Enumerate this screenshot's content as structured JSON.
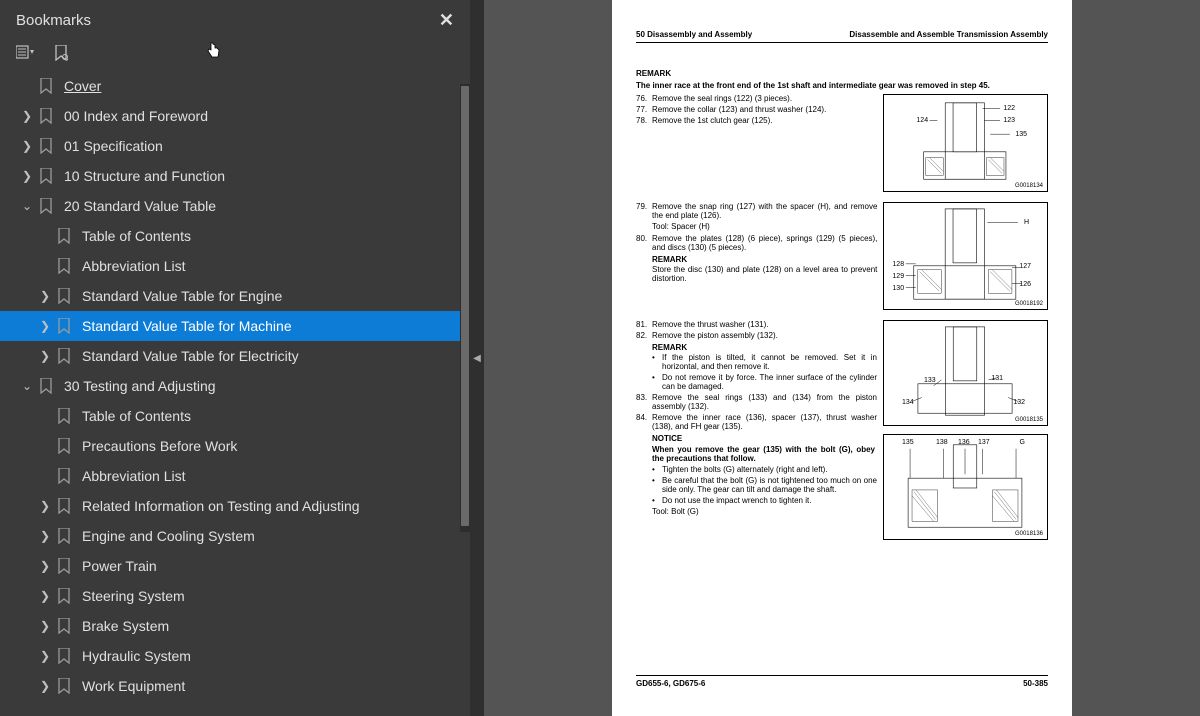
{
  "sidebar": {
    "title": "Bookmarks",
    "items": [
      {
        "label": "Cover",
        "indent": 0,
        "expand": "none",
        "link": true
      },
      {
        "label": "00 Index and Foreword",
        "indent": 0,
        "expand": "closed"
      },
      {
        "label": "01 Specification",
        "indent": 0,
        "expand": "closed"
      },
      {
        "label": "10 Structure and Function",
        "indent": 0,
        "expand": "closed"
      },
      {
        "label": "20 Standard Value Table",
        "indent": 0,
        "expand": "open"
      },
      {
        "label": "Table of Contents",
        "indent": 1,
        "expand": "none"
      },
      {
        "label": "Abbreviation List",
        "indent": 1,
        "expand": "none"
      },
      {
        "label": "Standard Value Table for Engine",
        "indent": 1,
        "expand": "closed"
      },
      {
        "label": "Standard Value Table for Machine",
        "indent": 1,
        "expand": "closed",
        "selected": true
      },
      {
        "label": "Standard Value Table for Electricity",
        "indent": 1,
        "expand": "closed"
      },
      {
        "label": "30 Testing and Adjusting",
        "indent": 0,
        "expand": "open"
      },
      {
        "label": "Table of Contents",
        "indent": 1,
        "expand": "none"
      },
      {
        "label": "Precautions Before Work",
        "indent": 1,
        "expand": "none"
      },
      {
        "label": "Abbreviation List",
        "indent": 1,
        "expand": "none"
      },
      {
        "label": "Related Information on Testing and Adjusting",
        "indent": 1,
        "expand": "closed"
      },
      {
        "label": "Engine and Cooling System",
        "indent": 1,
        "expand": "closed"
      },
      {
        "label": "Power Train",
        "indent": 1,
        "expand": "closed"
      },
      {
        "label": "Steering System",
        "indent": 1,
        "expand": "closed"
      },
      {
        "label": "Brake System",
        "indent": 1,
        "expand": "closed"
      },
      {
        "label": "Hydraulic System",
        "indent": 1,
        "expand": "closed"
      },
      {
        "label": "Work Equipment",
        "indent": 1,
        "expand": "closed"
      }
    ]
  },
  "page": {
    "header_left": "50 Disassembly and Assembly",
    "header_right": "Disassemble and Assemble Transmission Assembly",
    "remark_label": "REMARK",
    "notice_label": "NOTICE",
    "intro": "The inner race at the front end of the 1st shaft and intermediate gear was removed in step 45.",
    "block1": {
      "s76": "Remove the seal rings (122) (3 pieces).",
      "s77": "Remove the collar (123) and thrust washer (124).",
      "s78": "Remove the 1st clutch gear (125).",
      "fig": "G0018134",
      "labels": {
        "a": "124",
        "b": "122",
        "c": "123",
        "d": "135"
      }
    },
    "block2": {
      "s79": "Remove the snap ring (127) with the spacer (H), and remove the end plate (126).",
      "tool": "Tool: Spacer (H)",
      "s80": "Remove the plates (128) (6 piece), springs (129) (5 pieces), and discs (130) (5 pieces).",
      "remark_text": "Store the disc (130) and plate (128) on a level area to prevent distortion.",
      "fig": "G0018192",
      "labels": {
        "a": "128",
        "b": "129",
        "c": "130",
        "d": "127",
        "e": "126",
        "f": "H"
      }
    },
    "block3": {
      "s81": "Remove the thrust washer (131).",
      "s82": "Remove the piston assembly (132).",
      "b1": "If the piston is tilted, it cannot be removed. Set it in horizontal, and then remove it.",
      "b2": "Do not remove it by force. The inner surface of the cylinder can be damaged.",
      "s83": "Remove the seal rings (133) and (134) from the piston assembly (132).",
      "s84": "Remove the inner race (136), spacer (137), thrust washer (138), and FH gear (135).",
      "notice_text": "When you remove the gear (135) with the bolt (G), obey the precautions that follow.",
      "nb1": "Tighten the bolts (G) alternately (right and left).",
      "nb2": "Be careful that the bolt (G) is not tightened too much on one side only. The gear can tilt and damage the shaft.",
      "nb3": "Do not use the impact wrench to tighten it.",
      "tool": "Tool: Bolt (G)",
      "fig3": "G0018135",
      "fig3_labels": {
        "a": "133",
        "b": "131",
        "c": "134",
        "d": "132"
      },
      "fig4": "G0018136",
      "fig4_labels": {
        "a": "135",
        "b": "138",
        "c": "136",
        "d": "137",
        "e": "G"
      }
    },
    "footer_left": "GD655-6, GD675-6",
    "footer_right": "50-385"
  }
}
